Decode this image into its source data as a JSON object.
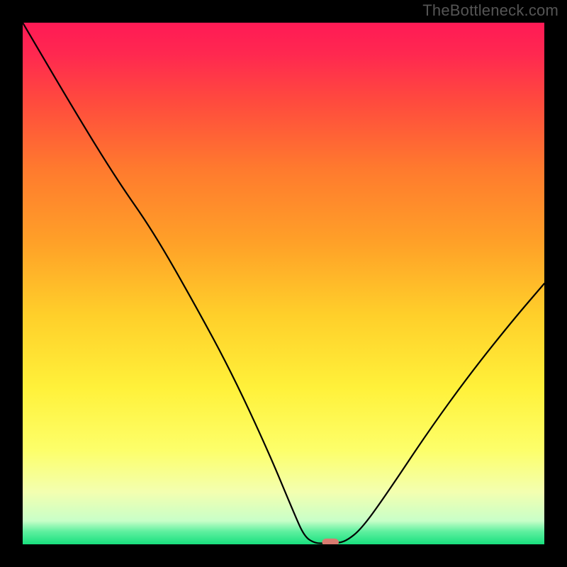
{
  "watermark": "TheBottleneck.com",
  "colors": {
    "frame": "#000000",
    "gradient_stops": [
      {
        "offset": 0.0,
        "color": "#ff1a55"
      },
      {
        "offset": 0.06,
        "color": "#ff2850"
      },
      {
        "offset": 0.15,
        "color": "#ff4a3e"
      },
      {
        "offset": 0.28,
        "color": "#ff7a2e"
      },
      {
        "offset": 0.42,
        "color": "#ffa028"
      },
      {
        "offset": 0.56,
        "color": "#ffcf2a"
      },
      {
        "offset": 0.7,
        "color": "#fff13a"
      },
      {
        "offset": 0.82,
        "color": "#fdff6a"
      },
      {
        "offset": 0.9,
        "color": "#f3ffb0"
      },
      {
        "offset": 0.955,
        "color": "#c8ffc8"
      },
      {
        "offset": 0.975,
        "color": "#60f0a0"
      },
      {
        "offset": 1.0,
        "color": "#18e07e"
      }
    ],
    "curve": "#000000",
    "marker": "#d97a70"
  },
  "chart_data": {
    "type": "line",
    "title": "",
    "xlabel": "",
    "ylabel": "",
    "xlim": [
      0,
      100
    ],
    "ylim": [
      0,
      100
    ],
    "legend": [],
    "grid": false,
    "annotations": [
      {
        "text": "TheBottleneck.com",
        "pos": "top-right"
      }
    ],
    "curve_points": [
      {
        "x": 0,
        "y": 100
      },
      {
        "x": 10,
        "y": 83
      },
      {
        "x": 18,
        "y": 70
      },
      {
        "x": 25,
        "y": 60
      },
      {
        "x": 33,
        "y": 46
      },
      {
        "x": 40,
        "y": 33
      },
      {
        "x": 47,
        "y": 18
      },
      {
        "x": 52,
        "y": 6
      },
      {
        "x": 54,
        "y": 1.5
      },
      {
        "x": 56,
        "y": 0.2
      },
      {
        "x": 58,
        "y": 0.2
      },
      {
        "x": 60,
        "y": 0.2
      },
      {
        "x": 62,
        "y": 0.6
      },
      {
        "x": 65,
        "y": 3
      },
      {
        "x": 70,
        "y": 10
      },
      {
        "x": 78,
        "y": 22
      },
      {
        "x": 86,
        "y": 33
      },
      {
        "x": 94,
        "y": 43
      },
      {
        "x": 100,
        "y": 50
      }
    ],
    "marker": {
      "x": 59,
      "y": 0.4,
      "w": 3.2,
      "h": 1.4
    }
  }
}
